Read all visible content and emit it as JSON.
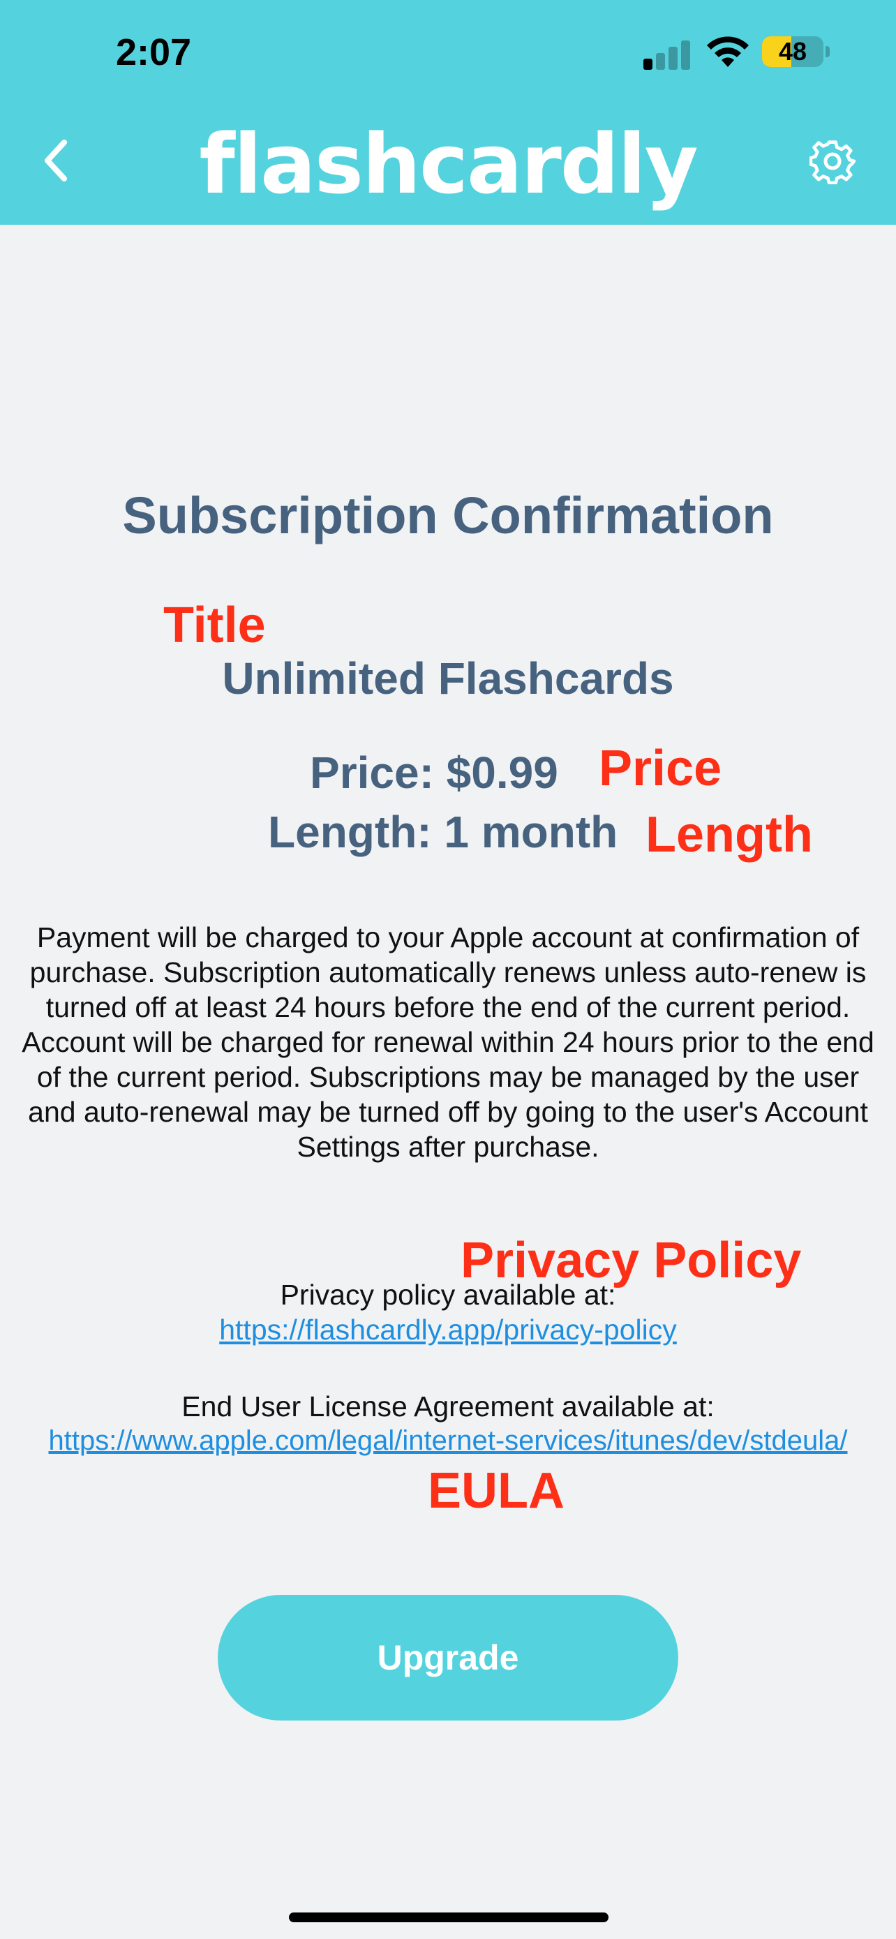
{
  "status_bar": {
    "time": "2:07",
    "battery_level": "48",
    "battery_fraction": 0.48,
    "battery_color": "#f9d21c"
  },
  "header": {
    "brand": "flashcardly",
    "back_icon": "chevron-left-icon",
    "settings_icon": "gear-icon",
    "background_color": "#54d3de"
  },
  "content": {
    "title": "Subscription Confirmation",
    "product_name": "Unlimited Flashcards",
    "price_label": "Price: $0.99",
    "length_label": "Length: 1 month",
    "terms": "Payment will be charged to your Apple account at confirmation of purchase. Subscription automatically renews unless auto-renew is turned off at least 24 hours before the end of the current period. Account will be charged for renewal within 24 hours prior to the end of the current period. Subscriptions may be managed by the user and auto-renewal may be turned off by going to the user's Account Settings after purchase.",
    "privacy_label": "Privacy policy available at:",
    "privacy_url": "https://flashcardly.app/privacy-policy",
    "eula_label": "End User License Agreement available at:",
    "eula_url": "https://www.apple.com/legal/internet-services/itunes/dev/stdeula/",
    "upgrade_label": "Upgrade"
  },
  "annotations": {
    "title": "Title",
    "price": "Price",
    "length": "Length",
    "privacy": "Privacy Policy",
    "eula": "EULA",
    "color": "#fd2f17"
  }
}
